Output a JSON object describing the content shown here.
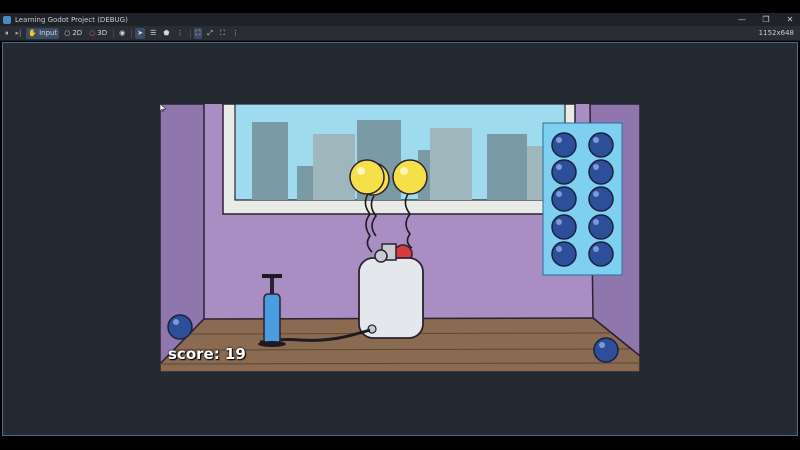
{
  "window": {
    "title": "Learning Godot Project (DEBUG)",
    "controls": [
      {
        "name": "minimize",
        "glyph": "—"
      },
      {
        "name": "restore",
        "glyph": "❐"
      },
      {
        "name": "close",
        "glyph": "✕"
      }
    ]
  },
  "toolbar": {
    "pause_glyph": "⏸",
    "step_glyph": "▸|",
    "input_label": "Input",
    "mode_2d_label": "2D",
    "mode_3d_label": "3D",
    "eye_glyph": "◉",
    "select_glyph": "➤",
    "list_glyph": "☰",
    "camera_glyph": "⬟",
    "more_glyph": "⋮",
    "frame_glyph": "⛶",
    "expand_glyph": "⤢",
    "fullscreen_glyph": "⛶",
    "resolution": "1152x648"
  },
  "game": {
    "score_text": "score: 19",
    "balloons_color": "#f6e04a",
    "ball_color": "#2d4f9a",
    "ammo_rack_count": 10,
    "pump_color": "#4a9de0",
    "tank_color": "#e4e8ec",
    "button_color": "#d93a3a"
  },
  "colors": {
    "accent": "#478cbf",
    "viewport_border": "#4a6a90",
    "wall": "#a88ec3",
    "floor": "#8a6a50",
    "sky": "#9edbee",
    "rack": "#7fd0f0"
  }
}
